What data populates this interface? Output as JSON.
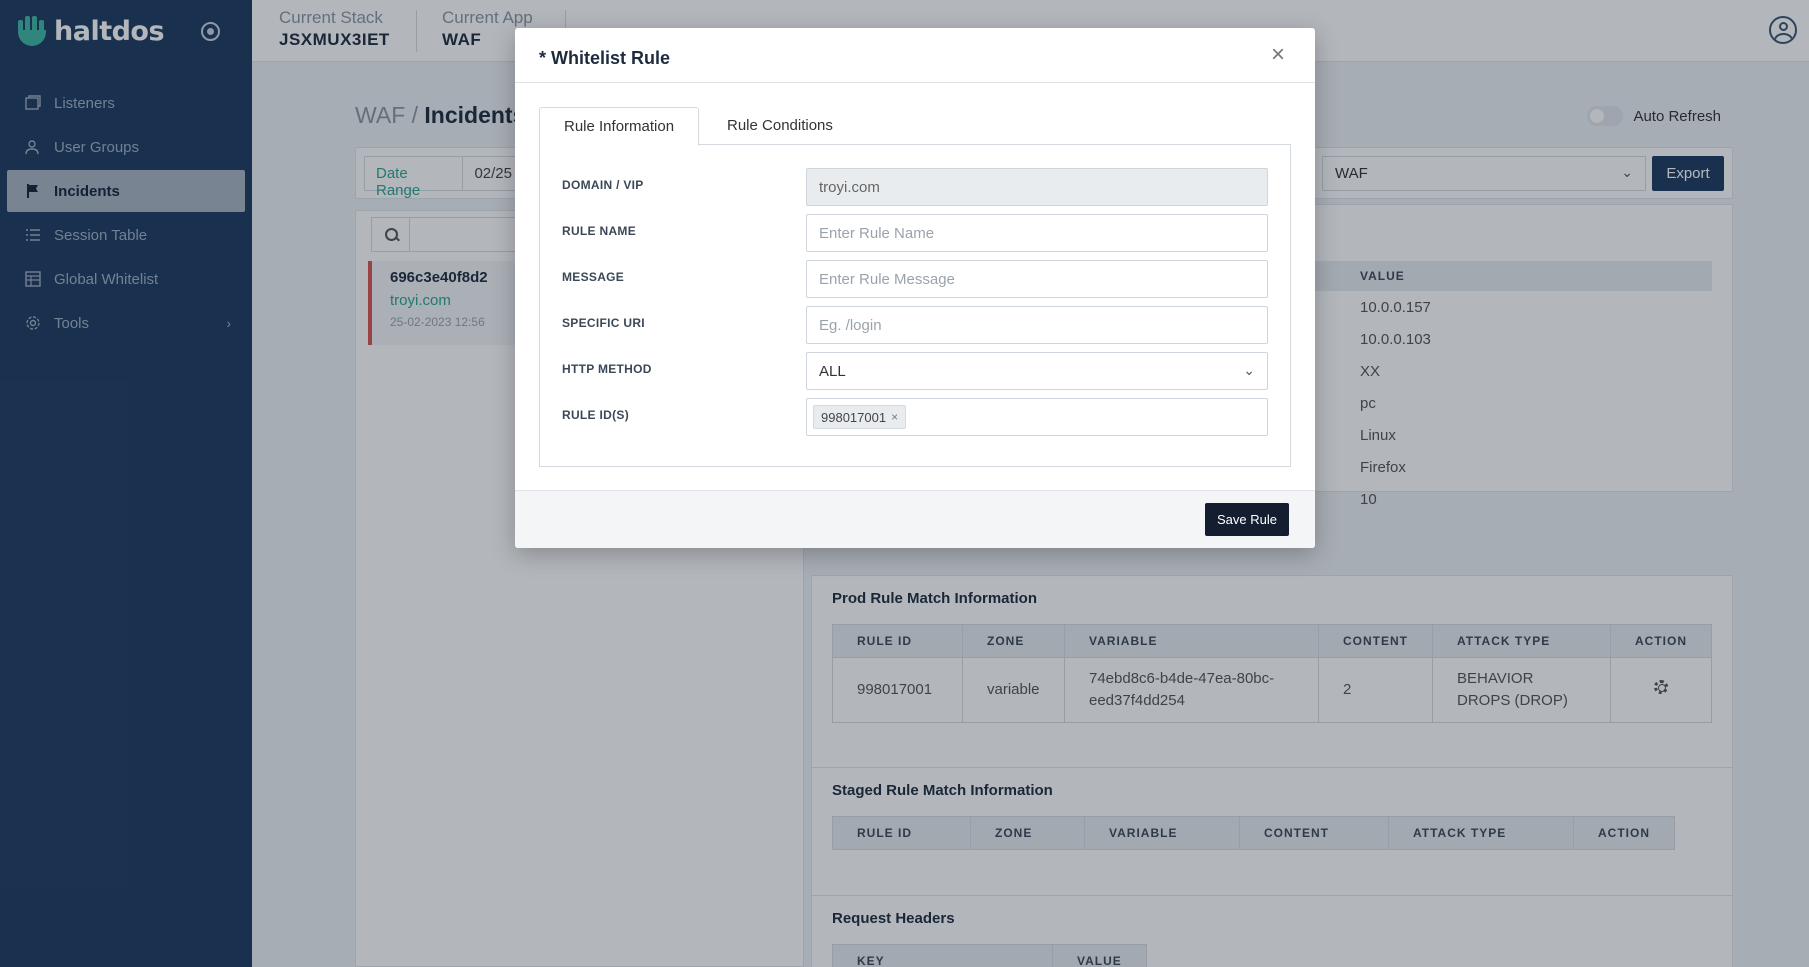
{
  "brand": {
    "name": "haltdos"
  },
  "sidebar": {
    "items": [
      {
        "label": "Listeners",
        "icon": "window-icon"
      },
      {
        "label": "User Groups",
        "icon": "users-icon"
      },
      {
        "label": "Incidents",
        "icon": "flag-icon",
        "active": true
      },
      {
        "label": "Session Table",
        "icon": "list-icon"
      },
      {
        "label": "Global Whitelist",
        "icon": "table-icon"
      },
      {
        "label": "Tools",
        "icon": "gear-icon"
      }
    ]
  },
  "header": {
    "stack_label": "Current Stack",
    "stack_value": "JSXMUX3IET",
    "app_label": "Current App",
    "app_value": "WAF"
  },
  "page": {
    "breadcrumb_parent": "WAF /",
    "breadcrumb_current": "Incidents",
    "auto_refresh_label": "Auto Refresh",
    "date_range_label": "Date Range",
    "date_range_value": "02/25",
    "app_select_value": "WAF",
    "export_label": "Export"
  },
  "incident": {
    "id": "696c3e40f8d2",
    "domain": "troyi.com",
    "time": "25-02-2023 12:56"
  },
  "details": {
    "value_header": "VALUE",
    "values": [
      "10.0.0.157",
      "10.0.0.103",
      "XX",
      "pc",
      "Linux",
      "Firefox",
      "10"
    ]
  },
  "prod_rules": {
    "title": "Prod Rule Match Information",
    "headers": [
      "RULE ID",
      "ZONE",
      "VARIABLE",
      "CONTENT",
      "ATTACK TYPE",
      "ACTION"
    ],
    "row": {
      "rule_id": "998017001",
      "zone": "variable",
      "variable": "74ebd8c6-b4de-47ea-80bc-eed37f4dd254",
      "content": "2",
      "attack_type": "BEHAVIOR DROPS (DROP)"
    }
  },
  "staged_rules": {
    "title": "Staged Rule Match Information",
    "headers": [
      "RULE ID",
      "ZONE",
      "VARIABLE",
      "CONTENT",
      "ATTACK TYPE",
      "ACTION"
    ]
  },
  "request_headers": {
    "title": "Request Headers",
    "key_header": "KEY",
    "value_header": "VALUE"
  },
  "modal": {
    "title": "* Whitelist Rule",
    "close": "×",
    "tabs": [
      "Rule Information",
      "Rule Conditions"
    ],
    "fields": {
      "domain_label": "DOMAIN / VIP",
      "domain_value": "troyi.com",
      "rule_name_label": "RULE NAME",
      "rule_name_placeholder": "Enter Rule Name",
      "message_label": "MESSAGE",
      "message_placeholder": "Enter Rule Message",
      "uri_label": "SPECIFIC URI",
      "uri_placeholder": "Eg. /login",
      "method_label": "HTTP METHOD",
      "method_value": "ALL",
      "rule_ids_label": "RULE ID(S)",
      "rule_id_tag": "998017001",
      "tag_remove": "×"
    },
    "save_label": "Save Rule"
  },
  "colors": {
    "sidebar_bg": "#1d3a5f",
    "accent": "#2aa58c",
    "danger": "#d9534f",
    "primary_button": "#141e30"
  }
}
